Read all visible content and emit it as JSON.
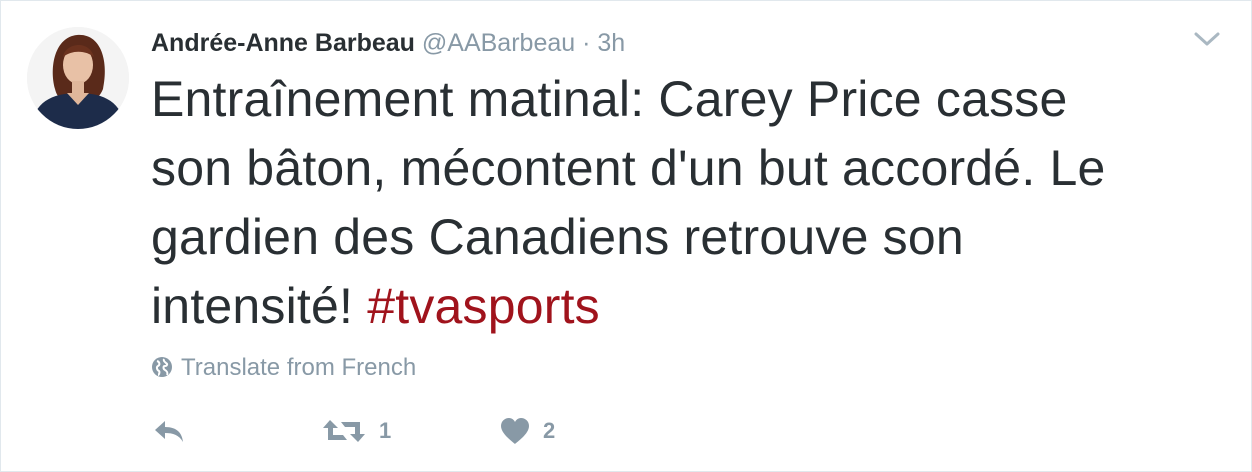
{
  "tweet": {
    "author": {
      "name": "Andrée-Anne Barbeau",
      "handle": "@AABarbeau",
      "separator": "·",
      "time": "3h",
      "avatar_icon": "profile-photo"
    },
    "text_lines": [
      "Entraînement matinal: Carey Price casse",
      "son bâton, mécontent d'un but accordé. Le",
      "gardien des Canadiens retrouve son",
      "intensité! "
    ],
    "hashtag": "#tvasports",
    "translate_label": "Translate from French",
    "actions": {
      "reply_icon": "reply-icon",
      "retweet_icon": "retweet-icon",
      "retweet_count": "1",
      "like_icon": "heart-icon",
      "like_count": "2"
    },
    "menu_icon": "chevron-down-icon"
  },
  "colors": {
    "text": "#292f33",
    "muted": "#8899a6",
    "hashtag": "#a0131c",
    "border": "#e1e8ed"
  }
}
